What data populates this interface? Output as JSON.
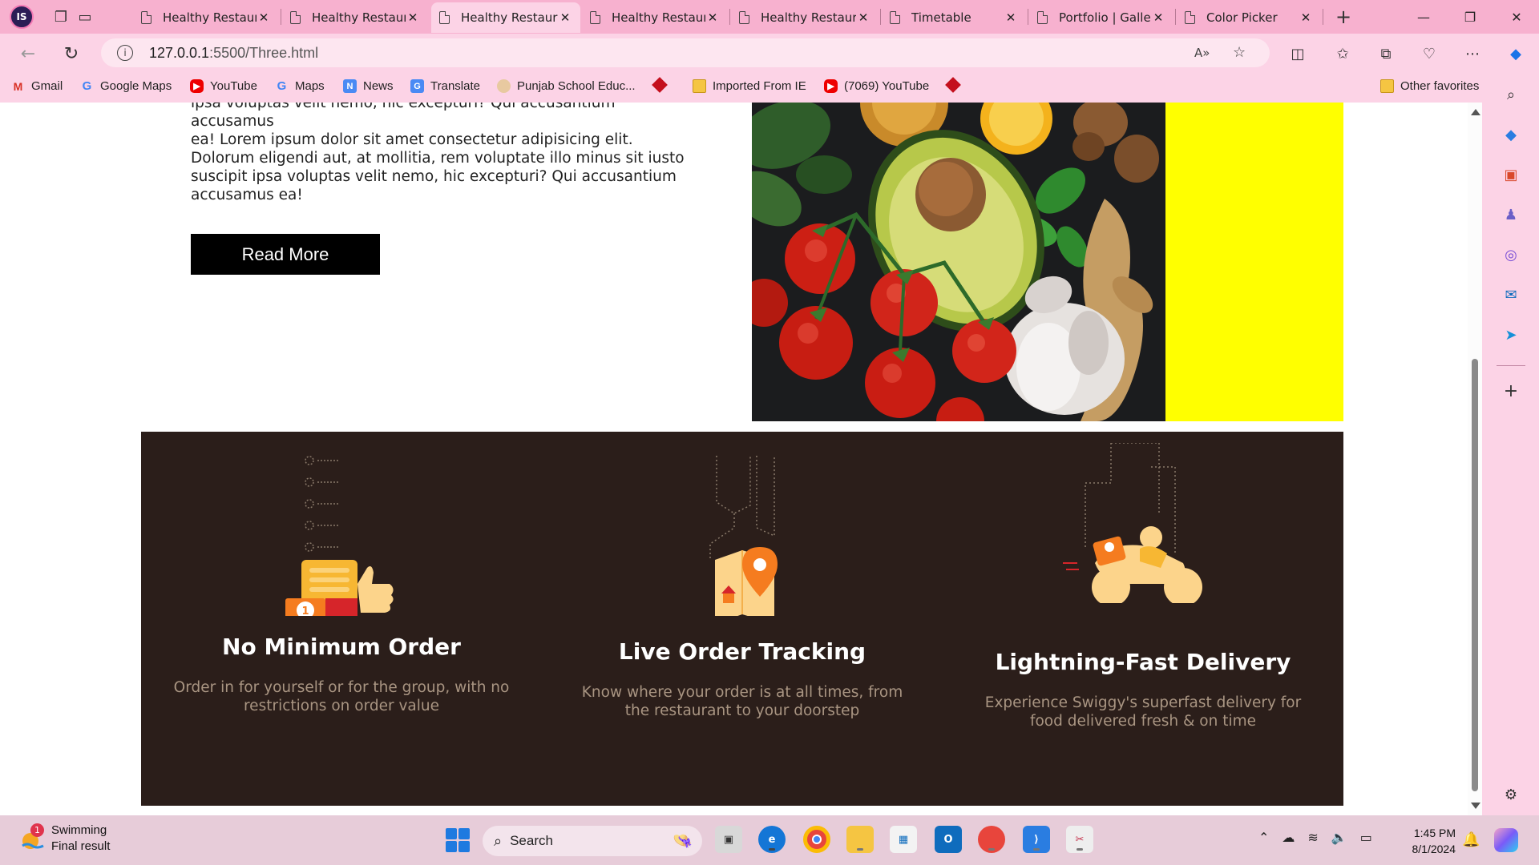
{
  "browser": {
    "tabs": [
      {
        "label": "Healthy Restaurant",
        "active": false
      },
      {
        "label": "Healthy Restaurant",
        "active": false
      },
      {
        "label": "Healthy Restaurant",
        "active": true
      },
      {
        "label": "Healthy Restaurant",
        "active": false
      },
      {
        "label": "Healthy Restaurant",
        "active": false
      },
      {
        "label": "Timetable",
        "active": false
      },
      {
        "label": "Portfolio | Gallery",
        "active": false
      },
      {
        "label": "Color Picker",
        "active": false
      }
    ],
    "profile_initials": "IS",
    "url_host": "127.0.0.1",
    "url_rest": ":5500/Three.html",
    "favorites": [
      {
        "label": "Gmail",
        "icon": "gmail-icon"
      },
      {
        "label": "Google Maps",
        "icon": "google-icon"
      },
      {
        "label": "YouTube",
        "icon": "youtube-icon"
      },
      {
        "label": "Maps",
        "icon": "google-icon"
      },
      {
        "label": "News",
        "icon": "news-icon"
      },
      {
        "label": "Translate",
        "icon": "translate-icon"
      },
      {
        "label": "Punjab School Educ...",
        "icon": "school-icon"
      },
      {
        "label": "Imported From IE",
        "icon": "folder-icon"
      },
      {
        "label": "(7069) YouTube",
        "icon": "youtube-icon"
      }
    ],
    "other_favorites": "Other favorites"
  },
  "page": {
    "intro_line_clipped": "ipsa voluptas velit nemo, hic excepturi? Qui accusantium accusamus",
    "intro_text": "ea! Lorem ipsum dolor sit amet consectetur adipisicing elit. Dolorum eligendi aut, at mollitia, rem voluptate illo minus sit iusto suscipit ipsa voluptas velit nemo, hic excepturi? Qui accusantium accusamus ea!",
    "read_more": "Read More",
    "accent_yellow": "#ffff00",
    "features_bg": "#2b1e1a",
    "features": [
      {
        "title": "No Minimum Order",
        "desc": "Order in for yourself or for the group, with no restrictions on order value"
      },
      {
        "title": "Live Order Tracking",
        "desc": "Know where your order is at all times, from the restaurant to your doorstep"
      },
      {
        "title": "Lightning-Fast Delivery",
        "desc": "Experience Swiggy's superfast delivery for food delivered fresh & on time"
      }
    ]
  },
  "taskbar": {
    "weather_title": "Swimming",
    "weather_sub": "Final result",
    "weather_count": "1",
    "search_label": "Search",
    "time": "1:45 PM",
    "date": "8/1/2024"
  }
}
